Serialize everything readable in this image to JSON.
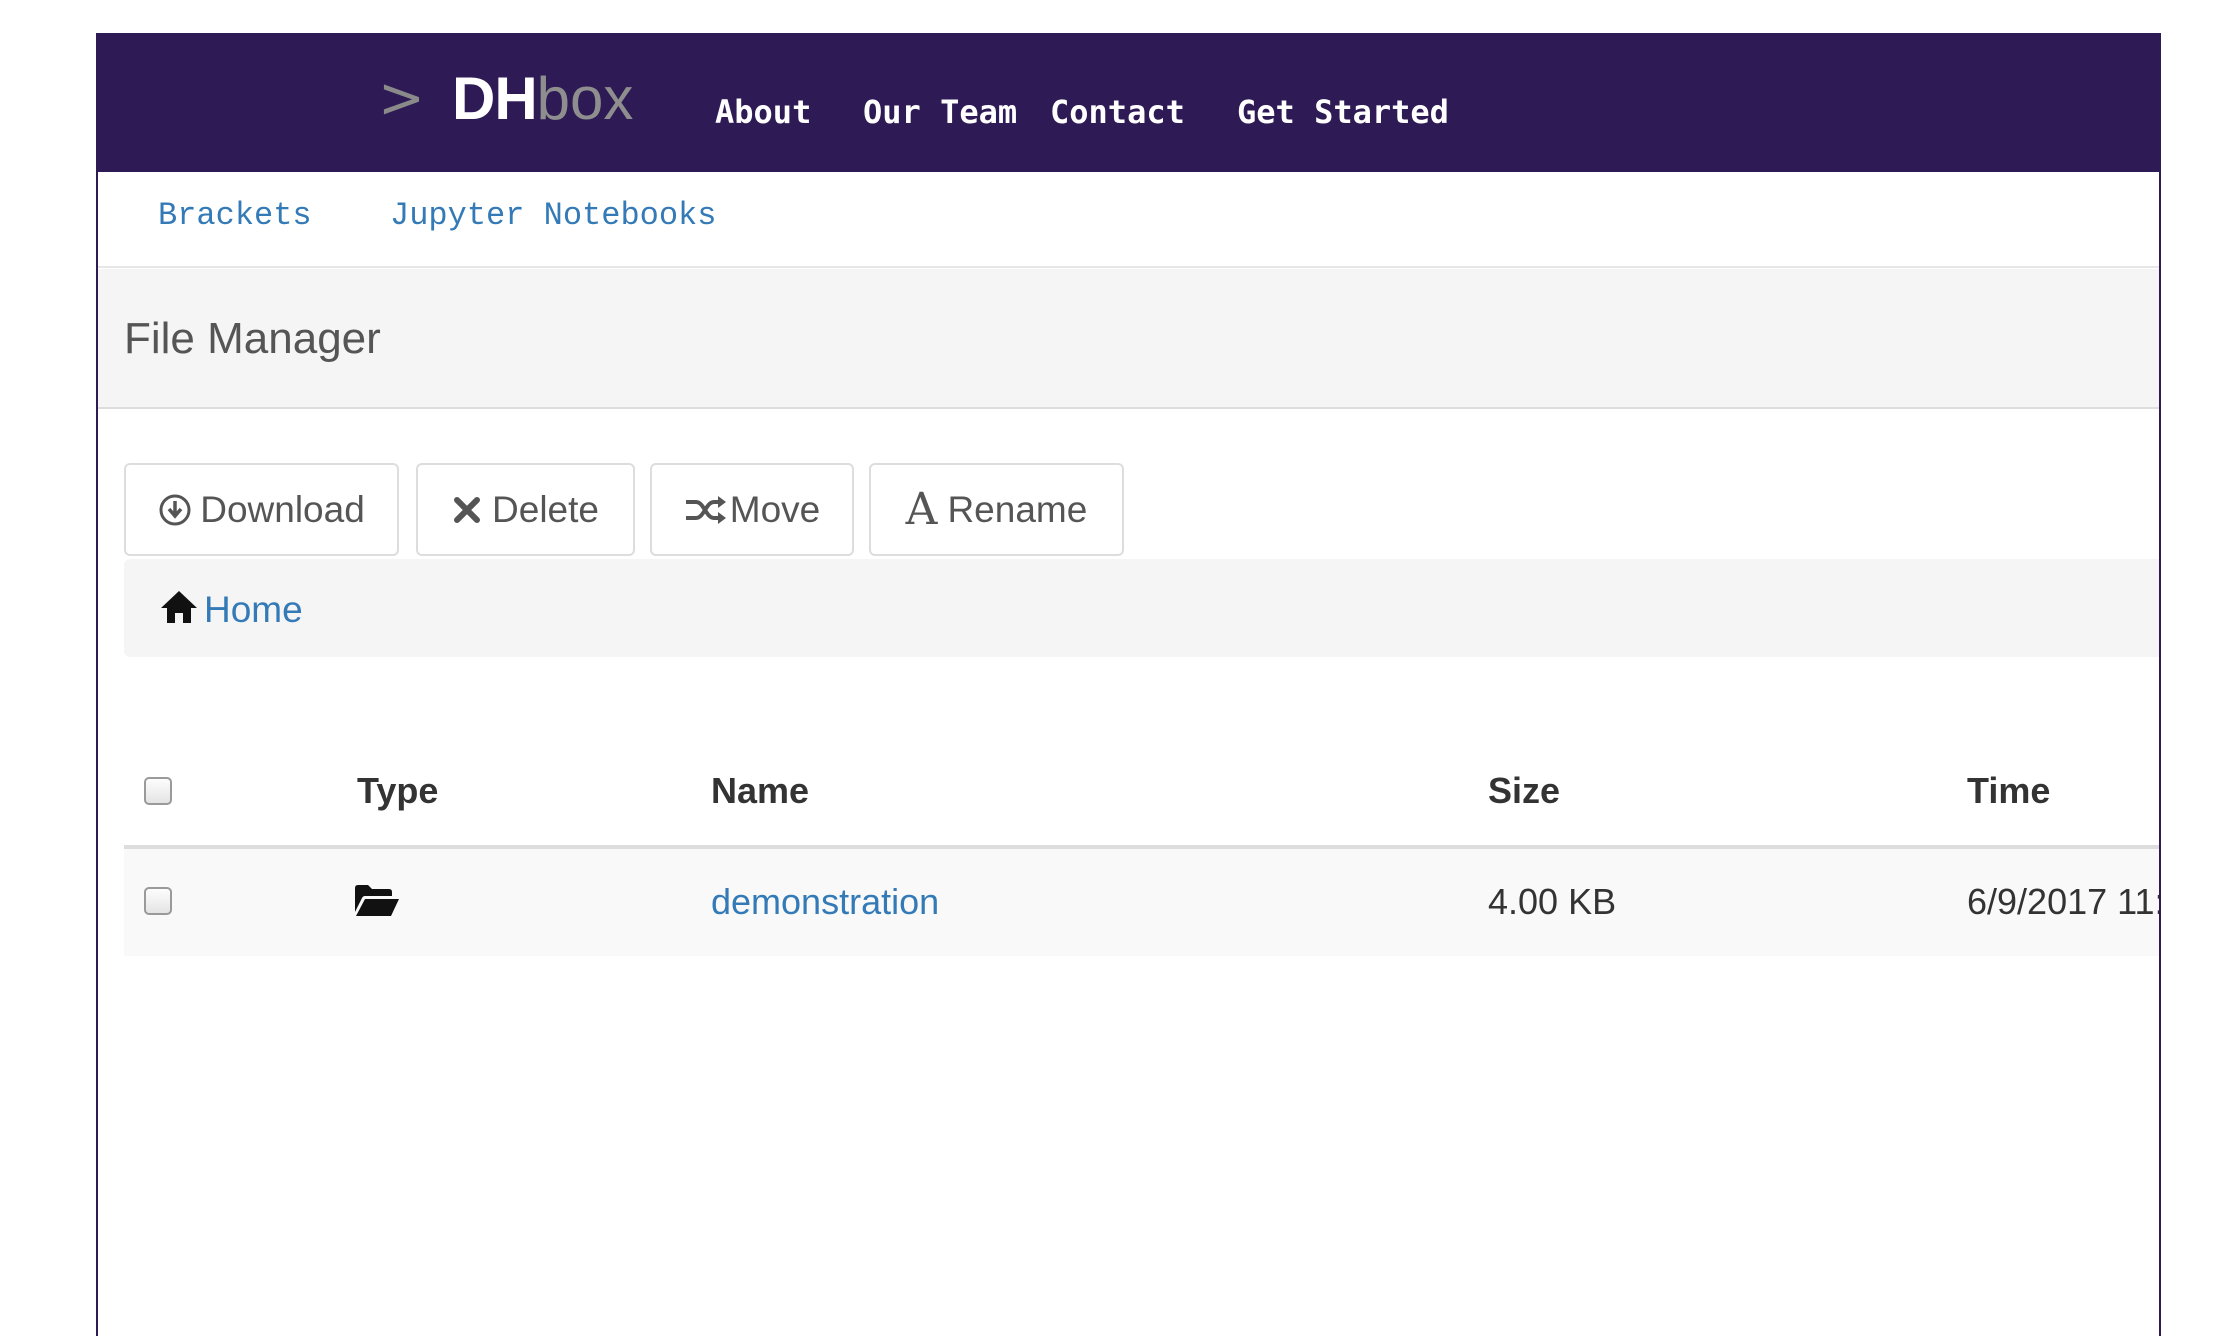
{
  "brand": {
    "prompt": ">",
    "part1": "DH",
    "part2": "box"
  },
  "nav": {
    "items": [
      "About",
      "Our Team",
      "Contact",
      "Get Started"
    ]
  },
  "subnav": {
    "items": [
      "Brackets",
      "Jupyter Notebooks"
    ]
  },
  "panel": {
    "title": "File Manager"
  },
  "toolbar": {
    "download_label": "Download",
    "delete_label": "Delete",
    "move_label": "Move",
    "rename_icon_glyph": "A",
    "rename_label": "Rename"
  },
  "breadcrumb": {
    "home_label": "Home"
  },
  "table": {
    "columns": [
      "Type",
      "Name",
      "Size",
      "Time"
    ],
    "rows": [
      {
        "type_icon": "folder-open-icon",
        "name": "demonstration",
        "size": "4.00 KB",
        "time": "6/9/2017 11:"
      }
    ]
  },
  "colors": {
    "nav_bg": "#2e1a55",
    "link": "#337ab7",
    "brand_box": "#8e8e8e"
  }
}
